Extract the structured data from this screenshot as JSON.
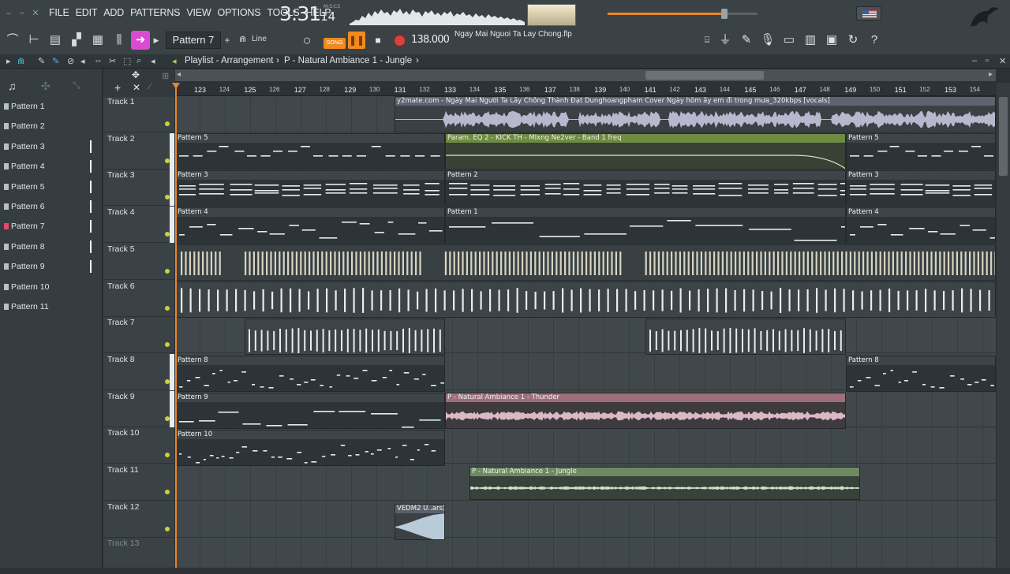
{
  "menu": [
    "FILE",
    "EDIT",
    "ADD",
    "PATTERNS",
    "VIEW",
    "OPTIONS",
    "TOOLS",
    "HELP"
  ],
  "clock": {
    "main": "3:31",
    "sub": "14",
    "unit": "M:S:CS"
  },
  "toolbar": {
    "pattern": "Pattern 7",
    "snap": "Line",
    "song_label": "SONG",
    "tempo": "138.000",
    "filename": "Ngay Mai Nguoi Ta Lay Chong.flp"
  },
  "master_volume": 0.78,
  "playlist": {
    "title": "Playlist - Arrangement",
    "separator": "›",
    "current_clip": "P - Natural Ambiance 1 - Jungle"
  },
  "patterns": [
    "Pattern 1",
    "Pattern 2",
    "Pattern 3",
    "Pattern 4",
    "Pattern 5",
    "Pattern 6",
    "Pattern 7",
    "Pattern 8",
    "Pattern 9",
    "Pattern 10",
    "Pattern 11"
  ],
  "selected_pattern_index": 6,
  "ruler": [
    "123",
    "124",
    "125",
    "126",
    "127",
    "128",
    "129",
    "130",
    "131",
    "132",
    "133",
    "134",
    "135",
    "136",
    "137",
    "138",
    "139",
    "140",
    "141",
    "142",
    "143",
    "144",
    "145",
    "146",
    "147",
    "148",
    "149",
    "150",
    "151",
    "152",
    "153",
    "154"
  ],
  "tracks": [
    "Track 1",
    "Track 2",
    "Track 3",
    "Track 4",
    "Track 5",
    "Track 6",
    "Track 7",
    "Track 8",
    "Track 9",
    "Track 10",
    "Track 11",
    "Track 12",
    "Track 13"
  ],
  "clips": {
    "vocals": "y2mate.com - Ngày Mai Người Ta Lấy Chồng  Thành Đạt  Dunghoangpham Cover  Ngày hôm ấy em đi trong mưa_320kbps [vocals]",
    "p5a": "Pattern 5",
    "param": "Param. EQ 2 - KICK TH - MIxng Ne2ver - Band 1 freq",
    "p5b": "Pattern 5",
    "p3a": "Pattern 3",
    "p2": "Pattern 2",
    "p3b": "Pattern 3",
    "p4a": "Pattern 4",
    "p1": "Pattern 1",
    "p4b": "Pattern 4",
    "p8a": "Pattern 8",
    "p8b": "Pattern 8",
    "p9": "Pattern 9",
    "thunder": "P -  Natural Ambiance 1 - Thunder",
    "p10": "Pattern 10",
    "jungle": "P - Natural Ambiance 1 - Jungle",
    "vedm": "VEDM2 U..ars)"
  },
  "colors": {
    "accent": "#f08b1d",
    "led": "#c8d33a",
    "grid": "#40484c"
  }
}
